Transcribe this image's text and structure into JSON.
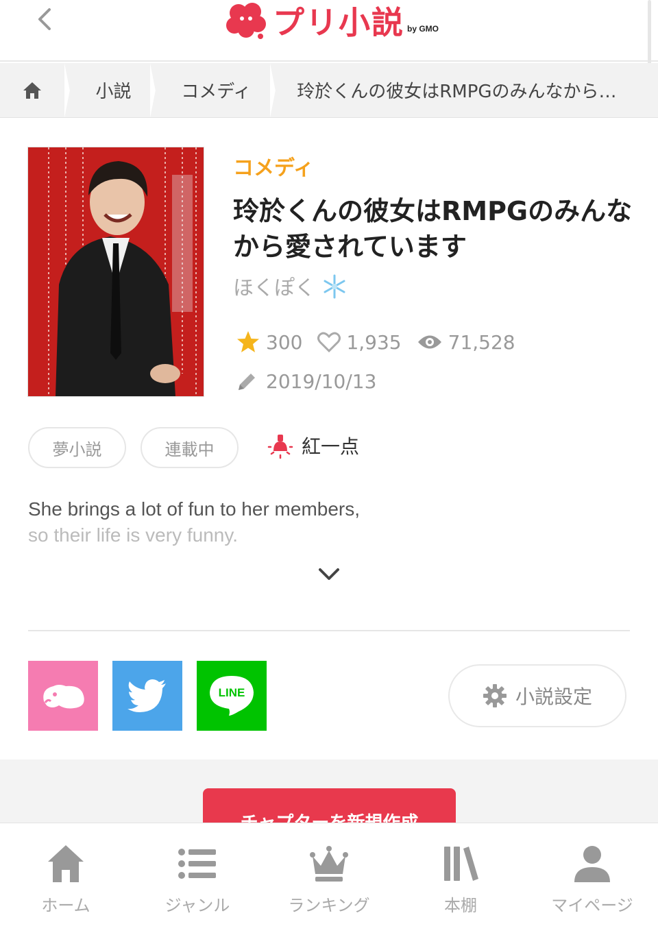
{
  "header": {
    "logo_text": "プリ小説",
    "logo_sub": "by GMO"
  },
  "breadcrumb": {
    "items": [
      "小説",
      "コメディ",
      "玲於くんの彼女はRMPGのみんなから…"
    ]
  },
  "novel": {
    "genre": "コメディ",
    "title": "玲於くんの彼女はRMPGのみんなから愛されています",
    "author": "ほくぽく",
    "author_icon": "snowflake-icon",
    "stats": {
      "stars": "300",
      "likes": "1,935",
      "views": "71,528"
    },
    "updated": "2019/10/13",
    "tags": [
      "夢小説",
      "連載中"
    ],
    "special_tag": "紅一点",
    "description_lines": [
      "She brings a lot of fun to her members,",
      "so their life is very funny."
    ]
  },
  "share": {
    "line_label": "LINE"
  },
  "settings_button": "小説設定",
  "create_button": "チャプターを新規作成",
  "bottom_nav": [
    {
      "label": "ホーム",
      "icon": "home-icon"
    },
    {
      "label": "ジャンル",
      "icon": "list-icon"
    },
    {
      "label": "ランキング",
      "icon": "crown-icon"
    },
    {
      "label": "本棚",
      "icon": "bookshelf-icon"
    },
    {
      "label": "マイページ",
      "icon": "person-icon"
    }
  ],
  "colors": {
    "brand": "#e8384f",
    "genre": "#f5a11c",
    "star": "#f5b51c",
    "twitter": "#4ca5ea",
    "line": "#00c300",
    "pri_share": "#f57cb1"
  }
}
